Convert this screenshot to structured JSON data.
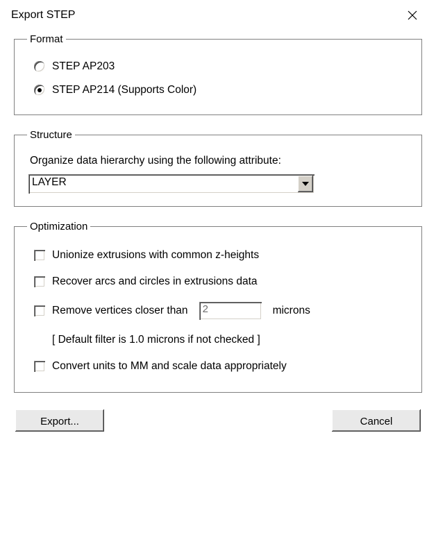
{
  "window": {
    "title": "Export STEP"
  },
  "format": {
    "legend": "Format",
    "options": {
      "ap203": {
        "label": "STEP AP203",
        "selected": false
      },
      "ap214": {
        "label": "STEP AP214 (Supports Color)",
        "selected": true
      }
    }
  },
  "structure": {
    "legend": "Structure",
    "label": "Organize data hierarchy using the following attribute:",
    "selected": "LAYER"
  },
  "optimization": {
    "legend": "Optimization",
    "unionize": {
      "label": "Unionize extrusions with common z-heights",
      "checked": false
    },
    "recover": {
      "label": "Recover arcs and circles in extrusions data",
      "checked": false
    },
    "filter": {
      "label": "Remove vertices closer than",
      "value": "2",
      "unit": "microns",
      "checked": false
    },
    "hint": "[ Default filter is 1.0 microns if not checked ]",
    "convert": {
      "label": "Convert units to MM and scale data appropriately",
      "checked": false
    }
  },
  "buttons": {
    "export": "Export...",
    "cancel": "Cancel"
  }
}
